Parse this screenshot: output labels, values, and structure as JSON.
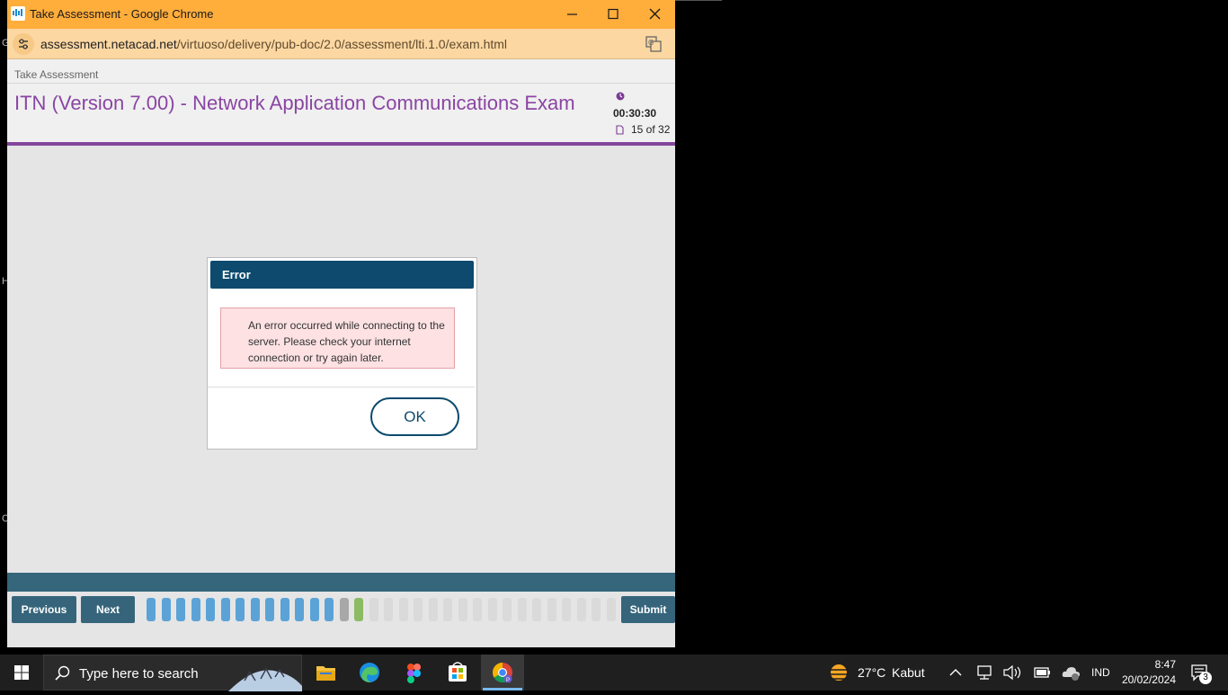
{
  "window": {
    "title": "Take Assessment - Google Chrome",
    "url_host": "assessment.netacad.net",
    "url_path": "/virtuoso/delivery/pub-doc/2.0/assessment/lti.1.0/exam.html"
  },
  "page": {
    "breadcrumb": "Take Assessment",
    "exam_title": "ITN (Version 7.00) - Network Application Communications Exam",
    "timer": "00:30:30",
    "question_count": "15 of 32"
  },
  "dialog": {
    "title": "Error",
    "message": "An error occurred while connecting to the server. Please check your internet connection or try again later.",
    "ok_label": "OK"
  },
  "nav": {
    "previous_label": "Previous",
    "next_label": "Next",
    "submit_label": "Submit",
    "questions": [
      "answered",
      "answered",
      "answered",
      "answered",
      "answered",
      "answered",
      "answered",
      "answered",
      "answered",
      "answered",
      "answered",
      "answered",
      "answered",
      "current-marked",
      "current",
      "unanswered",
      "unanswered",
      "unanswered",
      "unanswered",
      "unanswered",
      "unanswered",
      "unanswered",
      "unanswered",
      "unanswered",
      "unanswered",
      "unanswered",
      "unanswered",
      "unanswered",
      "unanswered",
      "unanswered",
      "unanswered",
      "unanswered"
    ]
  },
  "colors": {
    "answered": "#5ba3d6",
    "current-marked": "#a8a8a8",
    "current": "#8dbb63",
    "unanswered": "#dadada"
  },
  "taskbar": {
    "search_placeholder": "Type here to search",
    "weather_temp": "27°C",
    "weather_text": "Kabut",
    "language": "IND",
    "time": "8:47",
    "date": "20/02/2024",
    "notification_count": "3"
  }
}
